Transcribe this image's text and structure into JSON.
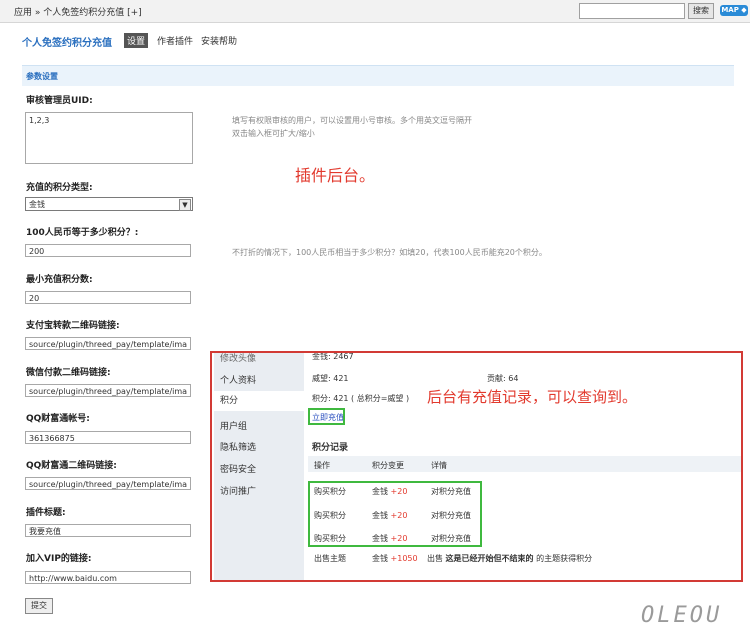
{
  "topbar": {
    "breadcrumb": "应用 » 个人免签约积分充值 [+]",
    "search_button": "搜索",
    "map_button": "MAP ◆"
  },
  "header": {
    "title": "个人免签约积分充值",
    "tabs": [
      "设置",
      "作者插件",
      "安装帮助"
    ]
  },
  "section": {
    "title": "参数设置"
  },
  "form": {
    "admin_uid": {
      "label": "审核管理员UID:",
      "value": "1,2,3",
      "hint_line1": "填写有权限审核的用户，可以设置用小号审核。多个用英文逗号隔开",
      "hint_line2": "双击输入框可扩大/缩小"
    },
    "credit_type": {
      "label": "充值的积分类型:",
      "value": "金钱"
    },
    "rate": {
      "label": "100人民币等于多少积分？:",
      "value": "200",
      "hint": "不打折的情况下，100人民币相当于多少积分？如填20，代表100人民币能充20个积分。"
    },
    "min_recharge": {
      "label": "最小充值积分数:",
      "value": "20"
    },
    "alipay_qr": {
      "label": "支付宝转款二维码链接:",
      "value": "source/plugin/threed_pay/template/ima"
    },
    "wechat_qr": {
      "label": "微信付款二维码链接:",
      "value": "source/plugin/threed_pay/template/ima"
    },
    "qq_account": {
      "label": "QQ财富通帐号:",
      "value": "361366875"
    },
    "qq_qr": {
      "label": "QQ财富通二维码链接:",
      "value": "source/plugin/threed_pay/template/ima"
    },
    "plugin_title": {
      "label": "插件标题:",
      "value": "我要充值"
    },
    "vip_link": {
      "label": "加入VIP的链接:",
      "value": "http://www.baidu.com"
    },
    "submit": "提交"
  },
  "annotations": {
    "backend": "插件后台。",
    "records": "后台有充值记录，可以查询到。"
  },
  "inset": {
    "nav": [
      "个人资料",
      "积分",
      "用户组",
      "隐私筛选",
      "密码安全",
      "访问推广"
    ],
    "nav_top_partial": "修改头像",
    "money_partial": "金钱: 2467",
    "weiwang": "威望: 421",
    "gongxian": "贡献: 64",
    "jifen": "积分: 421 ( 总积分=威望 )",
    "recharge_link": "立即充值",
    "records_title": "积分记录",
    "columns": [
      "操作",
      "积分变更",
      "详情"
    ],
    "rows": [
      {
        "op": "购买积分",
        "type": "金钱",
        "amount": "+20",
        "detail": "对积分充值"
      },
      {
        "op": "购买积分",
        "type": "金钱",
        "amount": "+20",
        "detail": "对积分充值"
      },
      {
        "op": "购买积分",
        "type": "金钱",
        "amount": "+20",
        "detail": "对积分充值"
      },
      {
        "op": "出售主题",
        "type": "金钱",
        "amount": "+1050",
        "detail_prefix": "出售",
        "detail_bold": "这是已经开始但不结束的",
        "detail_suffix": "的主题获得积分"
      }
    ]
  },
  "watermark": "OLEOU"
}
